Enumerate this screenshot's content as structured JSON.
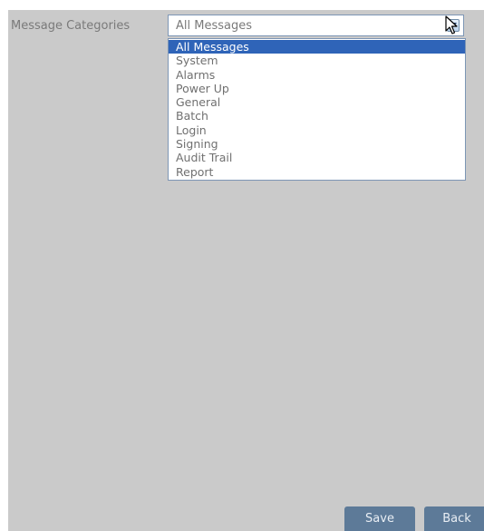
{
  "form": {
    "category_label": "Message Categories",
    "category_select": {
      "selected": "All Messages",
      "options": [
        "All Messages",
        "System",
        "Alarms",
        "Power Up",
        "General",
        "Batch",
        "Login",
        "Signing",
        "Audit Trail",
        "Report"
      ],
      "arrow_icon": "chevron-down-icon"
    }
  },
  "buttons": {
    "save": "Save",
    "back": "Back"
  },
  "colors": {
    "panel_bg": "#cacaca",
    "highlight": "#2f64b8",
    "button_bg": "#5d7a98",
    "border": "#7d96b5"
  }
}
